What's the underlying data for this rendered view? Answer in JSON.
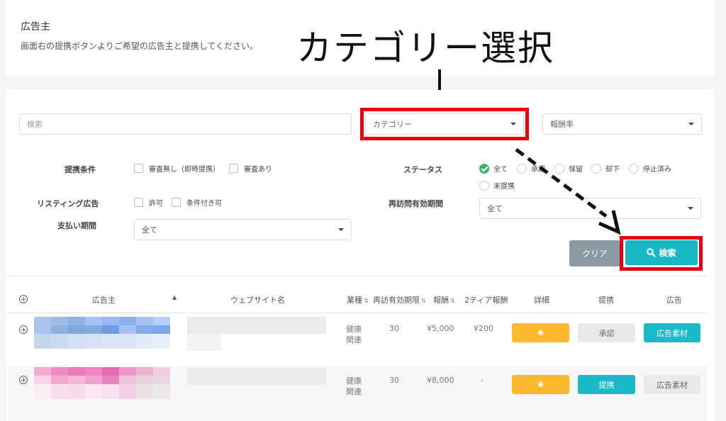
{
  "header": {
    "title": "広告主",
    "description": "画面右の提携ボタンよりご希望の広告主と提携してください。"
  },
  "annotation": {
    "title": "カテゴリー選択"
  },
  "filters": {
    "search_placeholder": "検索",
    "category_value": "カテゴリー",
    "reward_value": "報酬率",
    "conditions_label": "提携条件",
    "conditions_options": [
      "審査無し（即時提携）",
      "審査あり"
    ],
    "listing_label": "リスティング広告",
    "listing_options": [
      "許可",
      "条件付き可"
    ],
    "payment_label": "支払い期間",
    "payment_value": "全て",
    "status_label": "ステータス",
    "status_options": [
      "全て",
      "承認",
      "保留",
      "却下",
      "停止済み",
      "未提携"
    ],
    "status_selected": "全て",
    "revisit_label": "再訪問有効期間",
    "revisit_value": "全て",
    "clear_label": "クリア",
    "search_label": "検索"
  },
  "table": {
    "headers": [
      "広告主",
      "ウェブサイト名",
      "業種",
      "再訪有効期限",
      "報酬",
      "2ティア報酬",
      "詳細",
      "提携",
      "広告"
    ],
    "rows": [
      {
        "industry_line1": "健康",
        "industry_line2": "関連",
        "revisit": "30",
        "reward": "¥5,000",
        "tier2": "¥200",
        "partner_label": "承認",
        "ad_label": "広告素材"
      },
      {
        "industry_line1": "健康",
        "industry_line2": "関連",
        "revisit": "30",
        "reward": "¥8,000",
        "tier2": "-",
        "partner_label": "提携",
        "ad_label": "広告素材"
      }
    ]
  },
  "colors": {
    "accent_teal": "#19b6c6",
    "annotation_red": "#e60012",
    "detail_yellow": "#fbb92e",
    "mosaic_row1": [
      "#a9c4f0",
      "#9fbcec",
      "#8fb1ec",
      "#a5c0f2",
      "#9ab8ee",
      "#8cb0ea",
      "#a3c1f4",
      "#b8d0f7",
      "#a7c3ef",
      "#8fb0e0",
      "#7fa7da",
      "#86acdf",
      "#6f9be4",
      "#a4c1f3",
      "#86abe8",
      "#7ea6ee",
      "#c4d5ea",
      "#cbd9ee",
      "#d3e0f2",
      "#d6e2f3",
      "#dbe6f5",
      "#d9e5f5",
      "#e2ebf7",
      "#e7eef8"
    ],
    "mosaic_row2": [
      "#f4a9cf",
      "#ec8dc0",
      "#e87bb8",
      "#ef86c0",
      "#e56cb2",
      "#ec97c8",
      "#e8b5d1",
      "#f1cde0",
      "#f7d3e7",
      "#f2a8cf",
      "#f5b8d8",
      "#f0a3cd",
      "#e884bf",
      "#f0c3dc",
      "#e7d1dc",
      "#ecd6e2",
      "#fbeff5",
      "#f6e0ec",
      "#f9dcec",
      "#fbe8f2",
      "#f7e3ef",
      "#f4cfe4",
      "#ebe3e8",
      "#ede8eb"
    ]
  }
}
